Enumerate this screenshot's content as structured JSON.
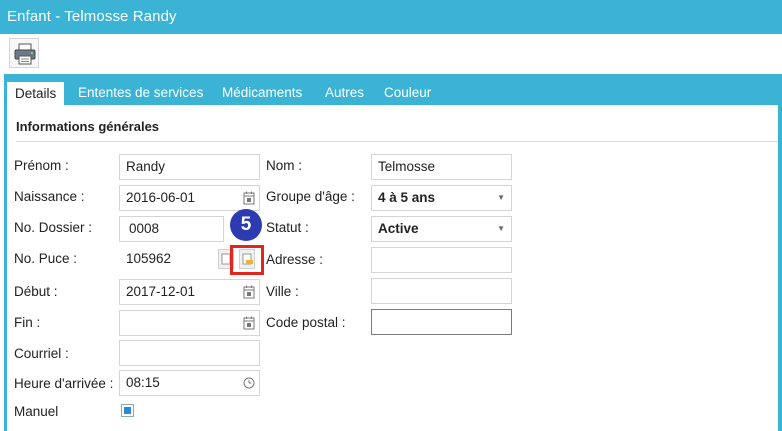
{
  "window": {
    "title": "Enfant - Telmosse Randy"
  },
  "toolbar": {
    "print_icon": "printer-icon"
  },
  "tabs": [
    {
      "label": "Details",
      "active": true
    },
    {
      "label": "Ententes de services"
    },
    {
      "label": "Médicaments"
    },
    {
      "label": "Autres"
    },
    {
      "label": "Couleur"
    }
  ],
  "section": {
    "title": "Informations générales"
  },
  "form": {
    "prenom": {
      "label": "Prénom :",
      "value": "Randy"
    },
    "nom": {
      "label": "Nom :",
      "value": "Telmosse"
    },
    "naissance": {
      "label": "Naissance :",
      "value": "2016-06-01",
      "icon": "calendar-icon"
    },
    "groupe_age": {
      "label": "Groupe d'âge :",
      "value": "4 à 5 ans"
    },
    "no_dossier": {
      "label": "No. Dossier :",
      "value": "0008"
    },
    "statut": {
      "label": "Statut :",
      "value": "Active"
    },
    "no_puce": {
      "label": "No. Puce :",
      "value": "105962"
    },
    "adresse": {
      "label": "Adresse :",
      "value": ""
    },
    "debut": {
      "label": "Début :",
      "value": "2017-12-01",
      "icon": "calendar-icon"
    },
    "ville": {
      "label": "Ville :",
      "value": ""
    },
    "fin": {
      "label": "Fin :",
      "value": "",
      "icon": "calendar-icon"
    },
    "code_postal": {
      "label": "Code postal :",
      "value": ""
    },
    "courriel": {
      "label": "Courriel :",
      "value": ""
    },
    "heure_arrivee": {
      "label": "Heure d'arrivée :",
      "value": "08:15",
      "icon": "clock-icon"
    },
    "manuel": {
      "label": "Manuel",
      "checked": true
    }
  },
  "annotation": {
    "step": "5",
    "color": "#e0261d",
    "badge_color": "#2c3cb0"
  },
  "colors": {
    "accent": "#3bb3d4"
  }
}
